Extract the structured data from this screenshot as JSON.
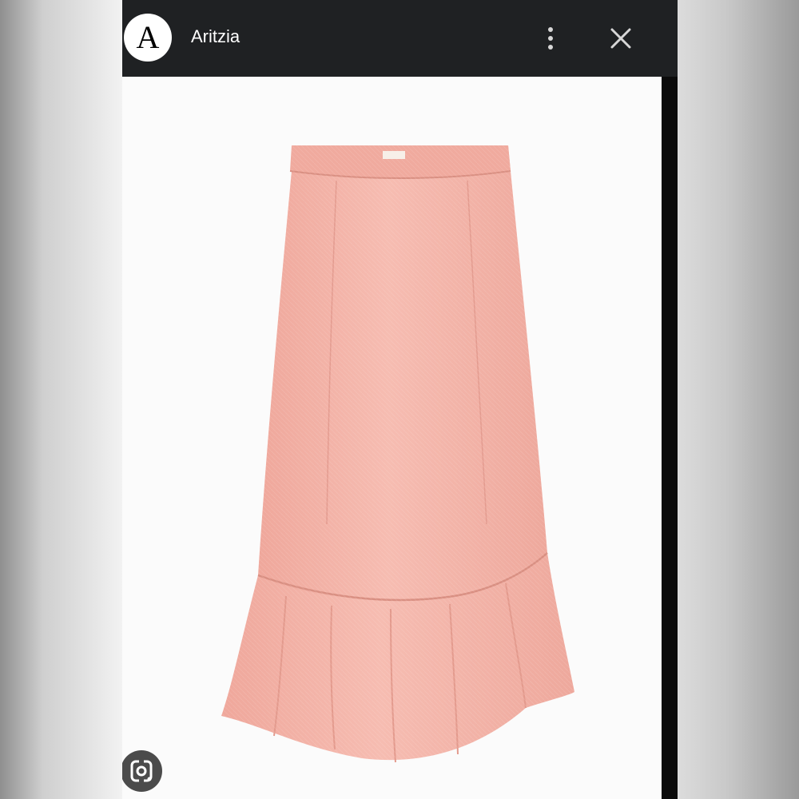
{
  "app": {
    "title": "Aritzia",
    "logo_letter": "A"
  },
  "icons": {
    "more": "more-vertical-icon",
    "close": "close-icon",
    "lens": "lens-search-icon"
  },
  "colors": {
    "topbar": "#1f2123",
    "skirt": "#f3b3a7",
    "background": "#fbfbfb"
  }
}
